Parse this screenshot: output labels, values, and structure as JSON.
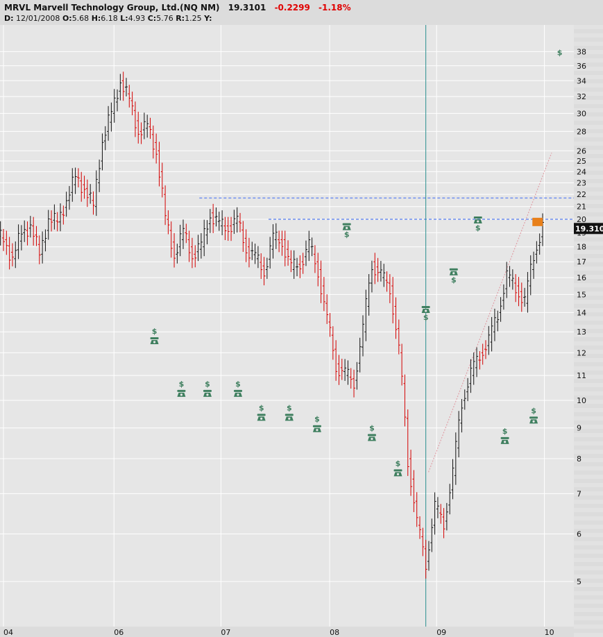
{
  "header": {
    "title": "MRVL Marvell Technology Group, Ltd.(NQ NM)",
    "last": "19.3101",
    "change": "-0.2299",
    "change_pct": "-1.18%",
    "d_label": "D:",
    "date": "12/01/2008",
    "o_label": "O:",
    "open": "5.68",
    "h_label": "H:",
    "high": "6.18",
    "l_label": "L:",
    "low": "4.93",
    "c_label": "C:",
    "close": "5.76",
    "r_label": "R:",
    "r": "1.25",
    "y_label": "Y:"
  },
  "colors": {
    "up": "#111111",
    "down": "#d40000",
    "grid": "#ffffff",
    "plot_bg": "#e6e6e6",
    "event": "#3f7f5f",
    "hline": "#6f8ff0",
    "vline": "#2a8f8f",
    "trend": "#e0a0a8",
    "marker": "#e8801a"
  },
  "chart_data": {
    "type": "ohlc",
    "scale": "log",
    "ylim": [
      4.6,
      40
    ],
    "y_ticks": [
      5,
      6,
      7,
      8,
      9,
      10,
      11,
      12,
      13,
      14,
      15,
      16,
      17,
      18,
      19,
      20,
      21,
      22,
      23,
      24,
      25,
      26,
      28,
      30,
      32,
      34,
      36,
      38
    ],
    "x_ticks": [
      {
        "label": "04",
        "month": 0
      },
      {
        "label": "06",
        "month": 12.3
      },
      {
        "label": "07",
        "month": 24.2
      },
      {
        "label": "08",
        "month": 36.3
      },
      {
        "label": "09",
        "month": 48.2
      },
      {
        "label": "10",
        "month": 60.2
      }
    ],
    "start": "monthly bars, index 0 = first bar",
    "closes": [
      18.5,
      17.2,
      19,
      19.5,
      17.5,
      20,
      19.8,
      21.5,
      23.5,
      22.5,
      21,
      27,
      30,
      34,
      31.5,
      28,
      28.5,
      26,
      20,
      17.5,
      19,
      17.5,
      18,
      20.5,
      19.5,
      19.5,
      19.8,
      18,
      17.2,
      16.5,
      18.5,
      18.5,
      16.5,
      17,
      18,
      16.5,
      13.5,
      11.5,
      11,
      10.8,
      13,
      17,
      16,
      15.5,
      12,
      8,
      6.2,
      5.4,
      6.6,
      6.3,
      7.5,
      10,
      11,
      12,
      12.5,
      14,
      16,
      15.5,
      14.5,
      17.5,
      19.31
    ],
    "last_price_label": "19.3101",
    "horizontal_lines": [
      {
        "price": 21.7,
        "from_month": 21.8
      },
      {
        "price": 20,
        "from_month": 29.5
      }
    ],
    "vertical_line_month": 47,
    "trend_line": {
      "from": {
        "month": 47.3,
        "price": 7.6
      },
      "to": {
        "month": 61,
        "price": 25.8
      }
    },
    "marker": {
      "month": 59.4,
      "price": 19.8
    },
    "events": [
      {
        "month": 16.8,
        "price": 12.6,
        "dollar": "above"
      },
      {
        "month": 19.8,
        "price": 10.3,
        "dollar": "above"
      },
      {
        "month": 22.7,
        "price": 10.3,
        "dollar": "above"
      },
      {
        "month": 26.1,
        "price": 10.3,
        "dollar": "above"
      },
      {
        "month": 28.7,
        "price": 9.4,
        "dollar": "above"
      },
      {
        "month": 31.8,
        "price": 9.4,
        "dollar": "above"
      },
      {
        "month": 34.9,
        "price": 9.0,
        "dollar": "above"
      },
      {
        "month": 38.2,
        "price": 19.5,
        "dollar": "below"
      },
      {
        "month": 41.0,
        "price": 8.7,
        "dollar": "above"
      },
      {
        "month": 43.9,
        "price": 7.6,
        "dollar": "above"
      },
      {
        "month": 47.0,
        "price": 14.2,
        "dollar": "below"
      },
      {
        "month": 50.1,
        "price": 16.4,
        "dollar": "below"
      },
      {
        "month": 52.8,
        "price": 20.0,
        "dollar": "below"
      },
      {
        "month": 55.8,
        "price": 8.6,
        "dollar": "above"
      },
      {
        "month": 59.0,
        "price": 9.3,
        "dollar": "above"
      }
    ],
    "dollar_only": [
      {
        "month": 61.9,
        "price": 37.5
      }
    ],
    "event_symbol": "$"
  }
}
